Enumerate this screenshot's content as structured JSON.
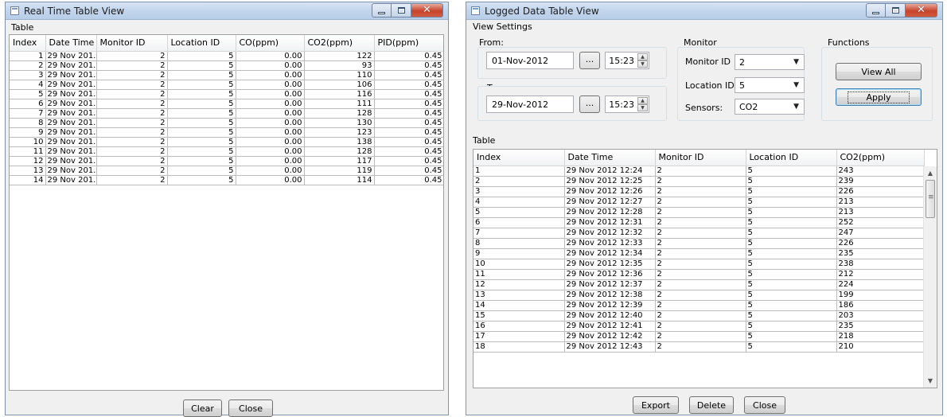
{
  "realtime": {
    "title": "Real Time Table View",
    "group_label": "Table",
    "columns": [
      "Index",
      "Date Time",
      "Monitor ID",
      "Location ID",
      "CO(ppm)",
      "CO2(ppm)",
      "PID(ppm)"
    ],
    "rows": [
      [
        "1",
        "29 Nov 201...",
        "2",
        "5",
        "0.00",
        "122",
        "0.45"
      ],
      [
        "2",
        "29 Nov 201...",
        "2",
        "5",
        "0.00",
        "93",
        "0.45"
      ],
      [
        "3",
        "29 Nov 201...",
        "2",
        "5",
        "0.00",
        "110",
        "0.45"
      ],
      [
        "4",
        "29 Nov 201...",
        "2",
        "5",
        "0.00",
        "106",
        "0.45"
      ],
      [
        "5",
        "29 Nov 201...",
        "2",
        "5",
        "0.00",
        "116",
        "0.45"
      ],
      [
        "6",
        "29 Nov 201...",
        "2",
        "5",
        "0.00",
        "111",
        "0.45"
      ],
      [
        "7",
        "29 Nov 201...",
        "2",
        "5",
        "0.00",
        "128",
        "0.45"
      ],
      [
        "8",
        "29 Nov 201...",
        "2",
        "5",
        "0.00",
        "130",
        "0.45"
      ],
      [
        "9",
        "29 Nov 201...",
        "2",
        "5",
        "0.00",
        "123",
        "0.45"
      ],
      [
        "10",
        "29 Nov 201...",
        "2",
        "5",
        "0.00",
        "138",
        "0.45"
      ],
      [
        "11",
        "29 Nov 201...",
        "2",
        "5",
        "0.00",
        "128",
        "0.45"
      ],
      [
        "12",
        "29 Nov 201...",
        "2",
        "5",
        "0.00",
        "117",
        "0.45"
      ],
      [
        "13",
        "29 Nov 201...",
        "2",
        "5",
        "0.00",
        "119",
        "0.45"
      ],
      [
        "14",
        "29 Nov 201...",
        "2",
        "5",
        "0.00",
        "114",
        "0.45"
      ]
    ],
    "clear_label": "Clear",
    "close_label": "Close"
  },
  "logged": {
    "title": "Logged Data Table View",
    "view_settings_label": "View Settings",
    "from_label": "From:",
    "from_date": "01-Nov-2012",
    "from_time": "15:23",
    "to_label": "To:",
    "to_date": "29-Nov-2012",
    "to_time": "15:23",
    "ellipsis_label": "...",
    "monitor_group_label": "Monitor",
    "monitor_id_label": "Monitor ID",
    "monitor_id_value": "2",
    "location_id_label": "Location ID",
    "location_id_value": "5",
    "sensors_label": "Sensors:",
    "sensors_value": "CO2",
    "functions_label": "Functions",
    "view_all_label": "View All",
    "apply_label": "Apply",
    "table_label": "Table",
    "columns": [
      "Index",
      "Date Time",
      "Monitor ID",
      "Location ID",
      "CO2(ppm)"
    ],
    "rows": [
      [
        "1",
        "29 Nov 2012 12:24",
        "2",
        "5",
        "243"
      ],
      [
        "2",
        "29 Nov 2012 12:25",
        "2",
        "5",
        "239"
      ],
      [
        "3",
        "29 Nov 2012 12:26",
        "2",
        "5",
        "226"
      ],
      [
        "4",
        "29 Nov 2012 12:27",
        "2",
        "5",
        "213"
      ],
      [
        "5",
        "29 Nov 2012 12:28",
        "2",
        "5",
        "213"
      ],
      [
        "6",
        "29 Nov 2012 12:31",
        "2",
        "5",
        "252"
      ],
      [
        "7",
        "29 Nov 2012 12:32",
        "2",
        "5",
        "247"
      ],
      [
        "8",
        "29 Nov 2012 12:33",
        "2",
        "5",
        "226"
      ],
      [
        "9",
        "29 Nov 2012 12:34",
        "2",
        "5",
        "235"
      ],
      [
        "10",
        "29 Nov 2012 12:35",
        "2",
        "5",
        "238"
      ],
      [
        "11",
        "29 Nov 2012 12:36",
        "2",
        "5",
        "212"
      ],
      [
        "12",
        "29 Nov 2012 12:37",
        "2",
        "5",
        "224"
      ],
      [
        "13",
        "29 Nov 2012 12:38",
        "2",
        "5",
        "199"
      ],
      [
        "14",
        "29 Nov 2012 12:39",
        "2",
        "5",
        "186"
      ],
      [
        "15",
        "29 Nov 2012 12:40",
        "2",
        "5",
        "203"
      ],
      [
        "16",
        "29 Nov 2012 12:41",
        "2",
        "5",
        "235"
      ],
      [
        "17",
        "29 Nov 2012 12:42",
        "2",
        "5",
        "218"
      ],
      [
        "18",
        "29 Nov 2012 12:43",
        "2",
        "5",
        "210"
      ]
    ],
    "export_label": "Export",
    "delete_label": "Delete",
    "close_label": "Close"
  },
  "icons": {
    "window": "window-icon",
    "minimize": "minimize-icon",
    "maximize": "maximize-icon",
    "close": "close-icon",
    "close_glyph": "✕",
    "dropdown": "chevron-down-icon",
    "dropdown_glyph": "▼",
    "spin_up_glyph": "▲",
    "spin_down_glyph": "▼",
    "scroll_up_glyph": "▲",
    "scroll_down_glyph": "▼"
  },
  "colors": {
    "title_gradient": "#c2d5ec",
    "close_button": "#c7432c",
    "window_bg": "#f0f0f0",
    "grid_line": "#bcbcbc"
  }
}
